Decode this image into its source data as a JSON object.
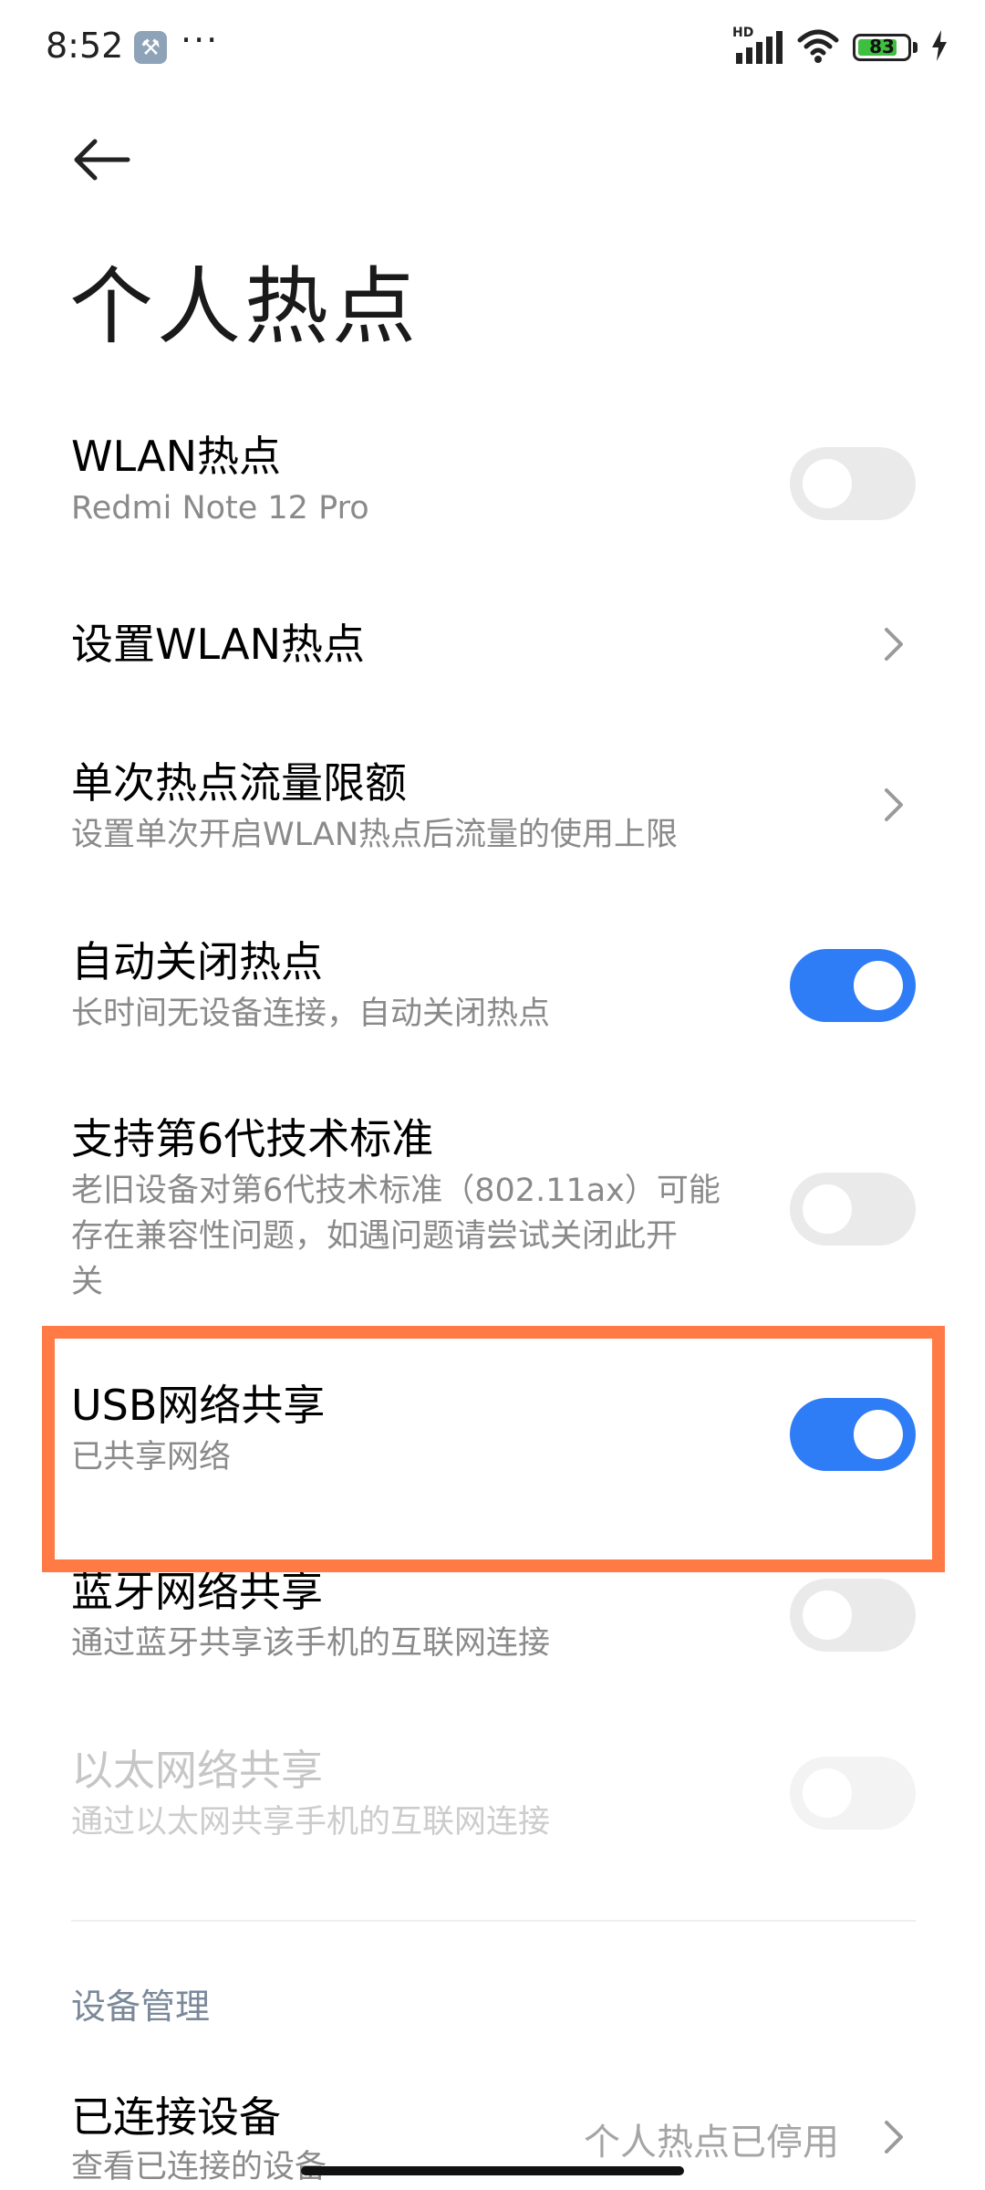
{
  "status_bar": {
    "time": "8:52",
    "network_badge": "HD",
    "battery_level": "83",
    "icons": [
      "wrench-icon",
      "more-dots-icon",
      "signal-icon",
      "wifi-icon",
      "battery-icon",
      "charging-icon"
    ],
    "colors": {
      "battery_fill": "#3fbf3f"
    }
  },
  "header": {
    "title": "个人热点"
  },
  "items": [
    {
      "title": "WLAN热点",
      "subtitle": "Redmi Note 12 Pro",
      "control": "toggle",
      "state": "off"
    },
    {
      "title": "设置WLAN热点",
      "control": "chevron"
    },
    {
      "title": "单次热点流量限额",
      "subtitle": "设置单次开启WLAN热点后流量的使用上限",
      "control": "chevron"
    },
    {
      "title": "自动关闭热点",
      "subtitle": "长时间无设备连接，自动关闭热点",
      "control": "toggle",
      "state": "on"
    },
    {
      "title": "支持第6代技术标准",
      "subtitle_lines": [
        "老旧设备对第6代技术标准（802.11ax）可能",
        "存在兼容性问题，如遇问题请尝试关闭此开",
        "关"
      ],
      "control": "toggle",
      "state": "off"
    },
    {
      "title": "USB网络共享",
      "subtitle": "已共享网络",
      "control": "toggle",
      "state": "on",
      "highlighted": true
    },
    {
      "title": "蓝牙网络共享",
      "subtitle": "通过蓝牙共享该手机的互联网连接",
      "control": "toggle",
      "state": "off"
    },
    {
      "title": "以太网络共享",
      "subtitle": "通过以太网共享手机的互联网连接",
      "control": "toggle",
      "state": "off",
      "disabled": true
    }
  ],
  "device_section": {
    "header": "设备管理",
    "item": {
      "title": "已连接设备",
      "subtitle": "查看已连接的设备",
      "value": "个人热点已停用"
    }
  },
  "colors": {
    "accent": "#2f7df6",
    "highlight_border": "#ff7a45"
  }
}
